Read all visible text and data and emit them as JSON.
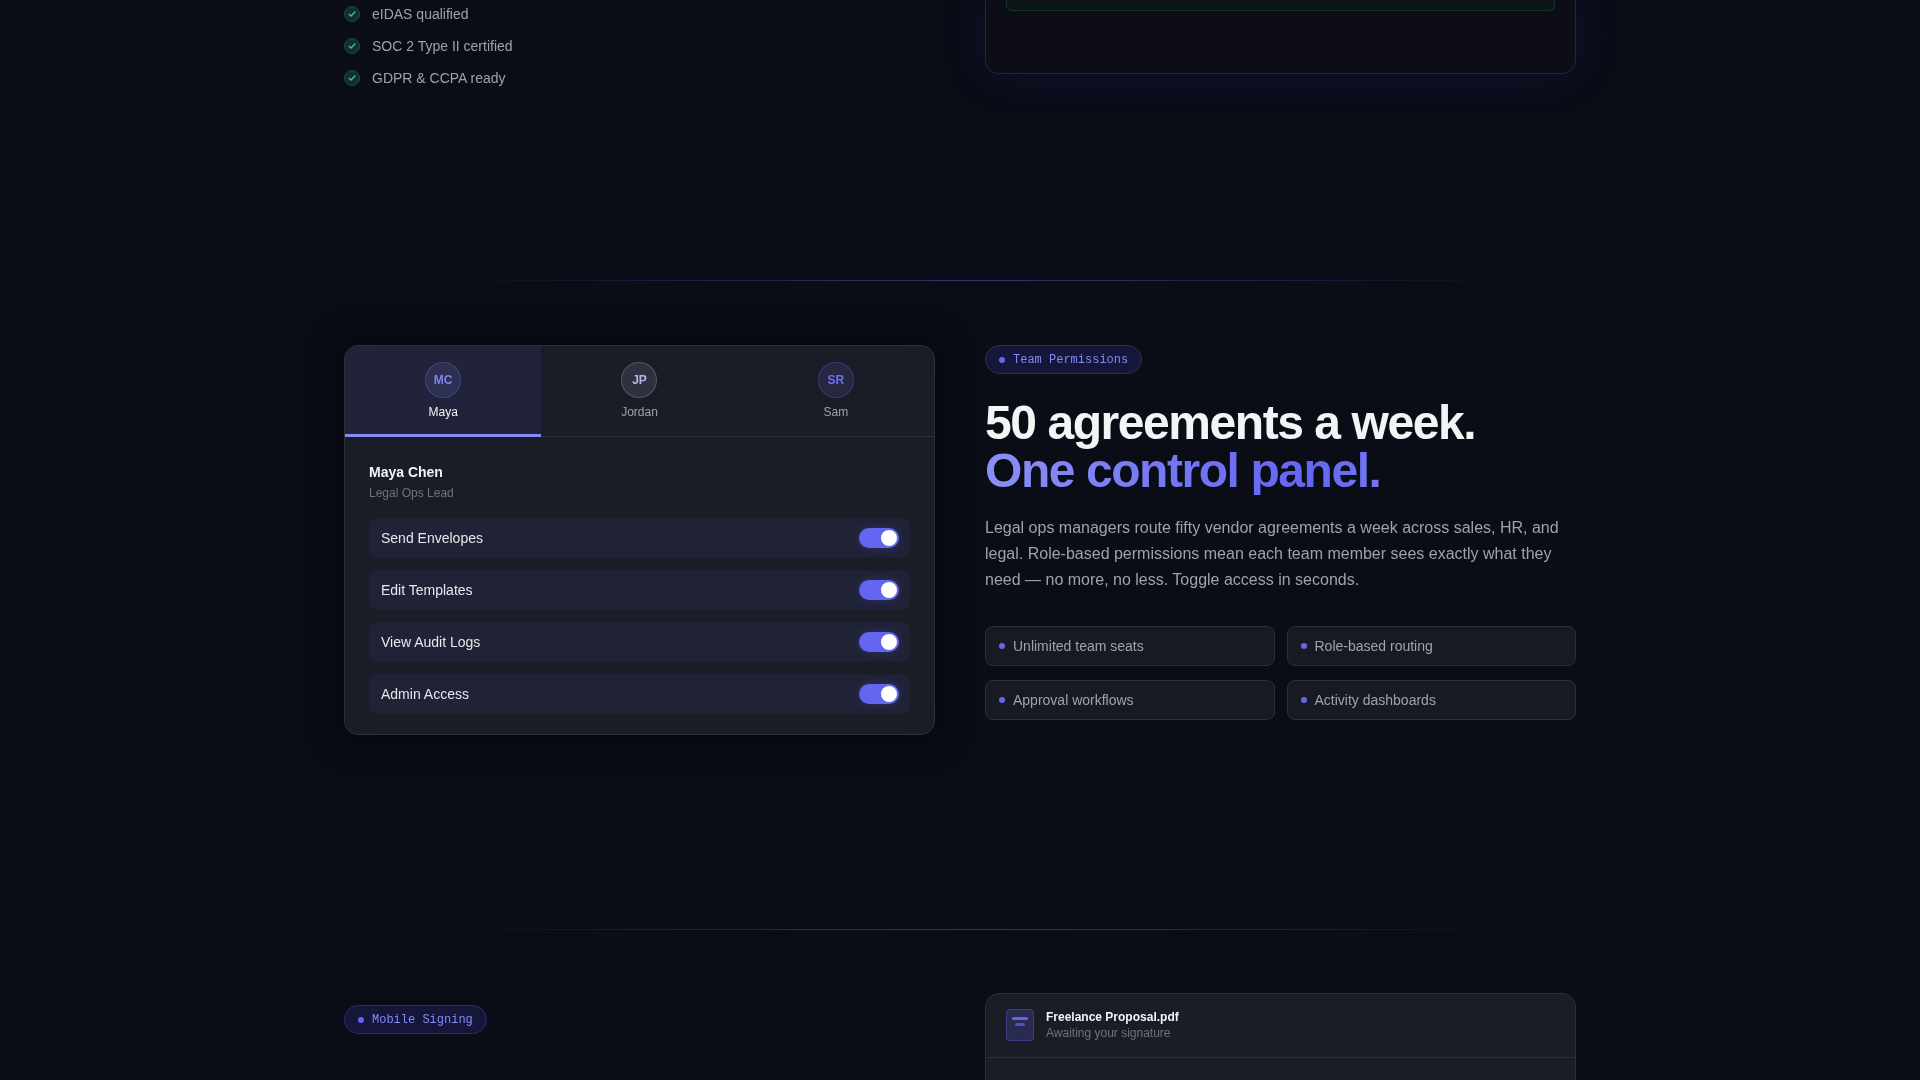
{
  "compliance_list": [
    "eIDAS qualified",
    "SOC 2 Type II certified",
    "GDPR & CCPA ready"
  ],
  "permissions_panel": {
    "members": [
      {
        "initials": "MC",
        "name": "Maya",
        "selected": true,
        "color": "#8083f0"
      },
      {
        "initials": "JP",
        "name": "Jordan",
        "selected": false,
        "color": "#b4b7e6"
      },
      {
        "initials": "SR",
        "name": "Sam",
        "selected": false,
        "color": "#6d70f5"
      }
    ],
    "profile": {
      "name": "Maya Chen",
      "role": "Legal Ops Lead"
    },
    "permissions": [
      {
        "label": "Send Envelopes",
        "on": true
      },
      {
        "label": "Edit Templates",
        "on": true
      },
      {
        "label": "View Audit Logs",
        "on": true
      },
      {
        "label": "Admin Access",
        "on": true
      }
    ]
  },
  "team_section": {
    "badge": "Team Permissions",
    "heading": "50 agreements a week.",
    "heading_accent": "One control panel.",
    "description": "Legal ops managers route fifty vendor agreements a week across sales, HR, and legal. Role-based permissions mean each team member sees exactly what they need — no more, no less. Toggle access in seconds.",
    "features": [
      "Unlimited team seats",
      "Role-based routing",
      "Approval workflows",
      "Activity dashboards"
    ]
  },
  "mobile_section": {
    "badge": "Mobile Signing",
    "document": {
      "name": "Freelance Proposal.pdf",
      "status": "Awaiting your signature"
    }
  }
}
